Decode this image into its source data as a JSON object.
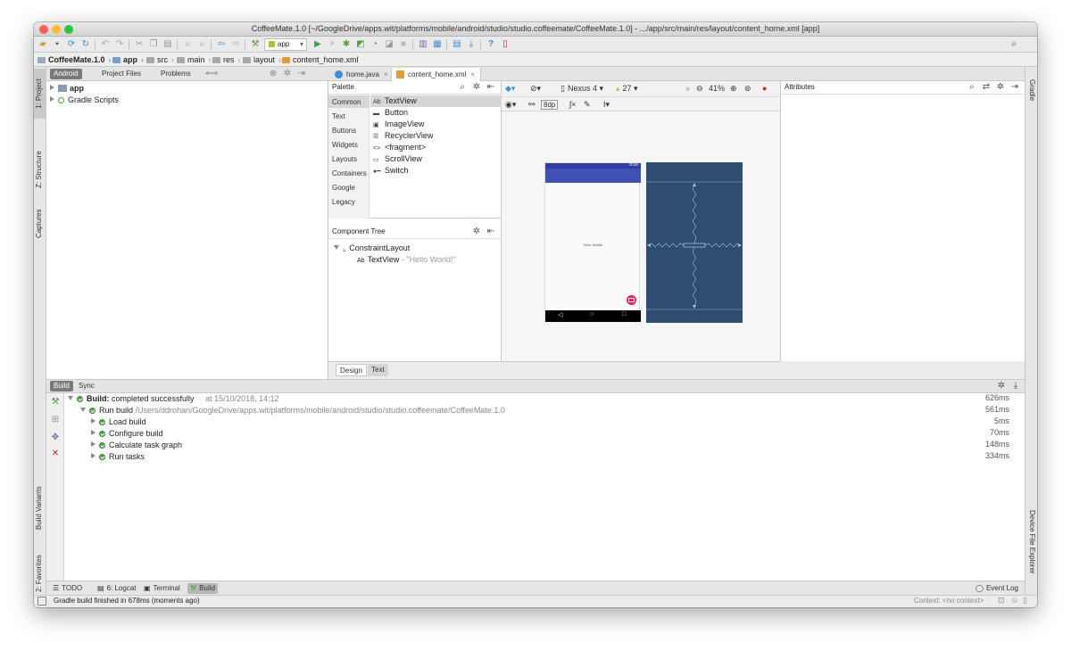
{
  "window": {
    "title": "CoffeeMate.1.0 [~/GoogleDrive/apps.wit/platforms/mobile/android/studio/studio.coffeemate/CoffeeMate.1.0] - .../app/src/main/res/layout/content_home.xml [app]"
  },
  "colors": {
    "close": "#fc5f57",
    "minimize": "#fdbc2e",
    "maximize": "#28c840",
    "blueprint": "#2f4e6f",
    "app_bar": "#3f51b5",
    "fab": "#e91e63",
    "success": "#52a447"
  },
  "toolbar": {
    "run_config": "app",
    "icons": [
      "folder-open-icon",
      "save-icon",
      "sync-icon",
      "refresh-icon",
      "undo-icon",
      "redo-icon",
      "cut-icon",
      "copy-icon",
      "paste-icon",
      "find-icon",
      "replace-icon",
      "back-icon",
      "forward-icon",
      "hammer-icon",
      "run-icon",
      "apply-changes-icon",
      "debug-icon",
      "profile-icon",
      "attach-icon",
      "stop-icon",
      "avd-icon",
      "sdk-icon",
      "structure-icon",
      "download-icon",
      "help-icon",
      "device-icon",
      "search-icon"
    ]
  },
  "breadcrumbs": [
    "CoffeeMate.1.0",
    "app",
    "src",
    "main",
    "res",
    "layout",
    "content_home.xml"
  ],
  "project_panel": {
    "tabs": [
      "Android",
      "Project Files",
      "Problems"
    ],
    "tree": [
      {
        "label": "app"
      },
      {
        "label": "Gradle Scripts"
      }
    ]
  },
  "left_strip": {
    "project": "1: Project",
    "structure": "Z: Structure",
    "captures": "Captures",
    "build_variants": "Build Variants",
    "favorites": "2: Favorites"
  },
  "right_strip": {
    "gradle": "Gradle",
    "device_file_explorer": "Device File Explorer"
  },
  "editor_tabs": [
    {
      "label": "home.java"
    },
    {
      "label": "content_home.xml"
    }
  ],
  "palette": {
    "title": "Palette",
    "categories": [
      "Common",
      "Text",
      "Buttons",
      "Widgets",
      "Layouts",
      "Containers",
      "Google",
      "Legacy"
    ],
    "items": [
      {
        "icon": "Ab",
        "label": "TextView"
      },
      {
        "icon": "▬",
        "label": "Button"
      },
      {
        "icon": "▣",
        "label": "ImageView"
      },
      {
        "icon": "☰",
        "label": "RecyclerView"
      },
      {
        "icon": "<>",
        "label": "<fragment>"
      },
      {
        "icon": "▭",
        "label": "ScrollView"
      },
      {
        "icon": "●━",
        "label": "Switch"
      }
    ]
  },
  "component_tree": {
    "title": "Component Tree",
    "root": "ConstraintLayout",
    "child_icon": "Ab",
    "child": "TextView",
    "child_detail": "- \"Hello World!\""
  },
  "design_toolbar": {
    "device": "Nexus 4",
    "api": "27",
    "zoom": "41%",
    "margin": "8dp"
  },
  "preview": {
    "status_time": "8:00",
    "hello": "Hello World!"
  },
  "editor_bottom_tabs": [
    "Design",
    "Text"
  ],
  "attributes": {
    "title": "Attributes"
  },
  "build": {
    "tabs": [
      "Build",
      "Sync"
    ],
    "summary_bold": "Build:",
    "summary_text": "completed successfully",
    "summary_time": "at 15/10/2018, 14:12",
    "summary_duration": "626ms",
    "run_label": "Run build",
    "run_path": "/Users/ddrohan/GoogleDrive/apps.wit/platforms/mobile/android/studio/studio.coffeemate/CoffeeMate.1.0",
    "run_duration": "561ms",
    "tasks": [
      {
        "label": "Load build",
        "duration": "5ms"
      },
      {
        "label": "Configure build",
        "duration": "70ms"
      },
      {
        "label": "Calculate task graph",
        "duration": "148ms"
      },
      {
        "label": "Run tasks",
        "duration": "334ms"
      }
    ]
  },
  "bottom_tabs": [
    {
      "label": "TODO"
    },
    {
      "label": "6: Logcat"
    },
    {
      "label": "Terminal"
    },
    {
      "label": "Build"
    }
  ],
  "event_log": "Event Log",
  "status": {
    "message": "Gradle build finished in 678ms (moments ago)",
    "context": "Context: <no context>"
  }
}
